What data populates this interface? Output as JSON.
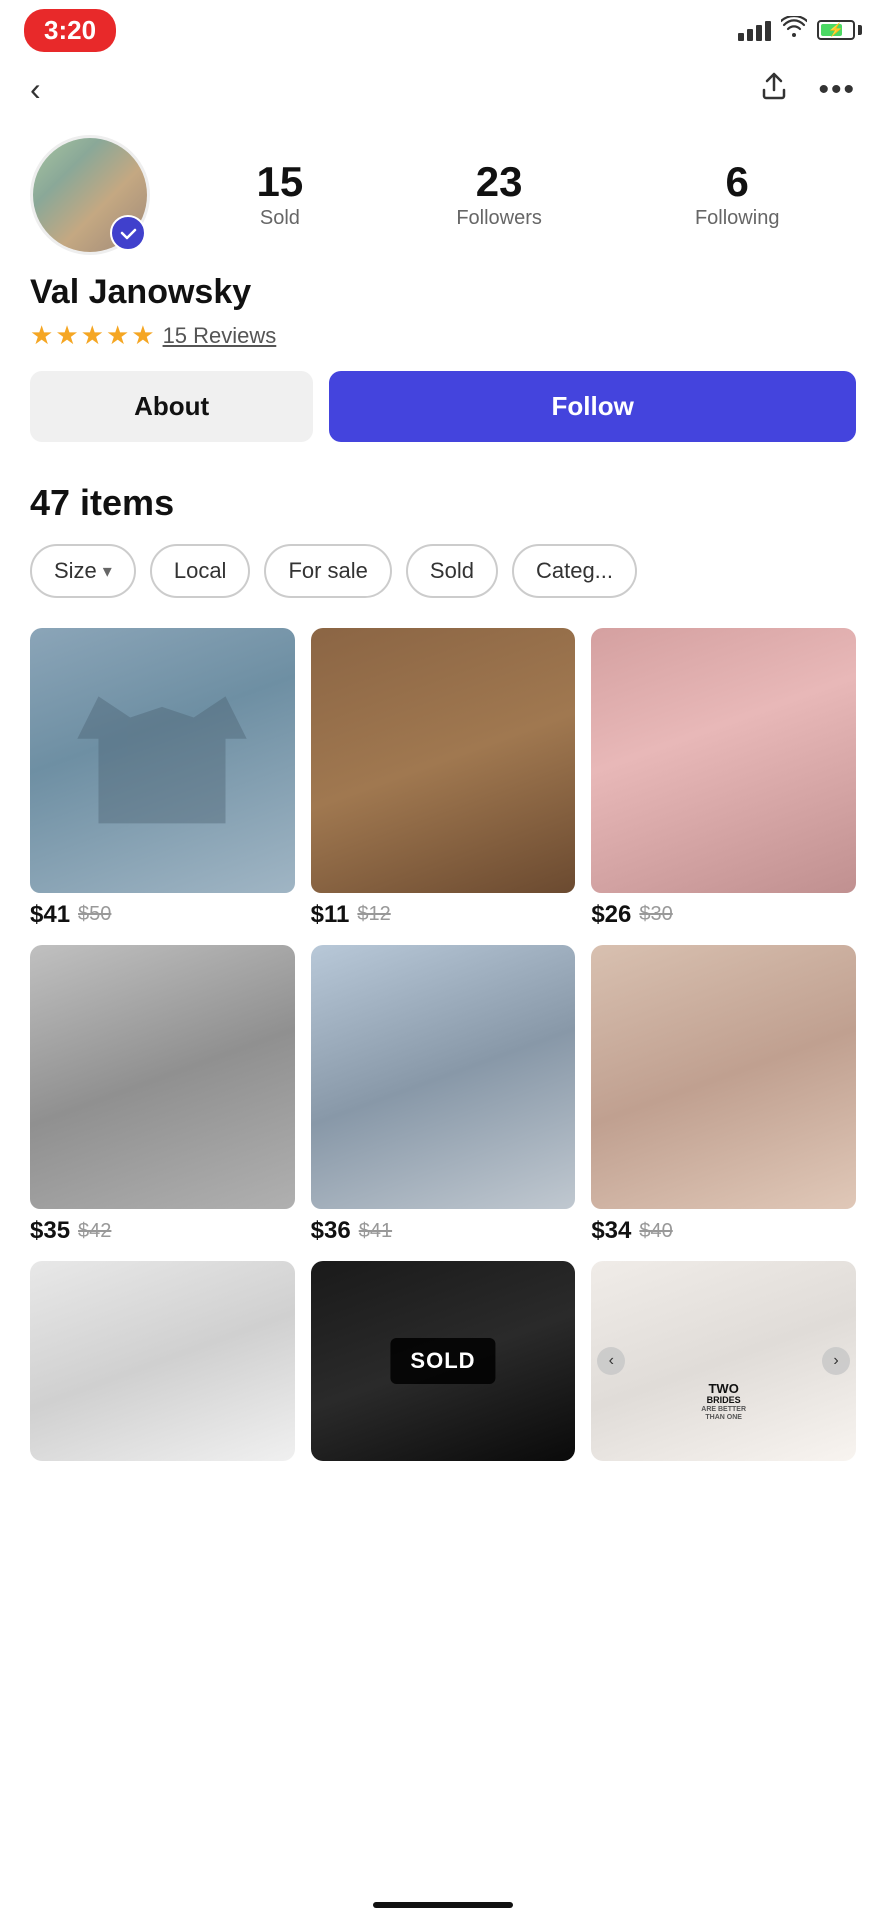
{
  "statusBar": {
    "time": "3:20",
    "battery": "70%"
  },
  "nav": {
    "backLabel": "‹",
    "shareLabel": "⬆",
    "moreLabel": "•••"
  },
  "profile": {
    "name": "Val Janowsky",
    "stats": {
      "sold": {
        "value": "15",
        "label": "Sold"
      },
      "followers": {
        "value": "23",
        "label": "Followers"
      },
      "following": {
        "value": "6",
        "label": "Following"
      }
    },
    "rating": 5,
    "reviewCount": "15",
    "reviewsLabel": "15 Reviews",
    "aboutButton": "About",
    "followButton": "Follow"
  },
  "items": {
    "count": "47 items",
    "filters": [
      {
        "label": "Size",
        "hasDropdown": true
      },
      {
        "label": "Local",
        "hasDropdown": false
      },
      {
        "label": "For sale",
        "hasDropdown": false
      },
      {
        "label": "Sold",
        "hasDropdown": false
      },
      {
        "label": "Categ...",
        "hasDropdown": false
      }
    ],
    "products": [
      {
        "id": 1,
        "imageClass": "img-jacket",
        "price": "$41",
        "originalPrice": "$50",
        "sold": false
      },
      {
        "id": 2,
        "imageClass": "img-sandal",
        "price": "$11",
        "originalPrice": "$12",
        "sold": false
      },
      {
        "id": 3,
        "imageClass": "img-ring",
        "price": "$26",
        "originalPrice": "$30",
        "sold": false
      },
      {
        "id": 4,
        "imageClass": "img-keychain",
        "price": "$35",
        "originalPrice": "$42",
        "sold": false
      },
      {
        "id": 5,
        "imageClass": "img-mickey",
        "price": "$36",
        "originalPrice": "$41",
        "sold": false
      },
      {
        "id": 6,
        "imageClass": "img-button-badge",
        "price": "$34",
        "originalPrice": "$40",
        "sold": false
      },
      {
        "id": 7,
        "imageClass": "img-skirt",
        "price": "",
        "originalPrice": "",
        "sold": false
      },
      {
        "id": 8,
        "imageClass": "img-boxing",
        "price": "",
        "originalPrice": "",
        "sold": true,
        "soldLabel": "SOLD"
      },
      {
        "id": 9,
        "imageClass": "img-tshirt",
        "price": "",
        "originalPrice": "",
        "sold": false
      }
    ]
  }
}
